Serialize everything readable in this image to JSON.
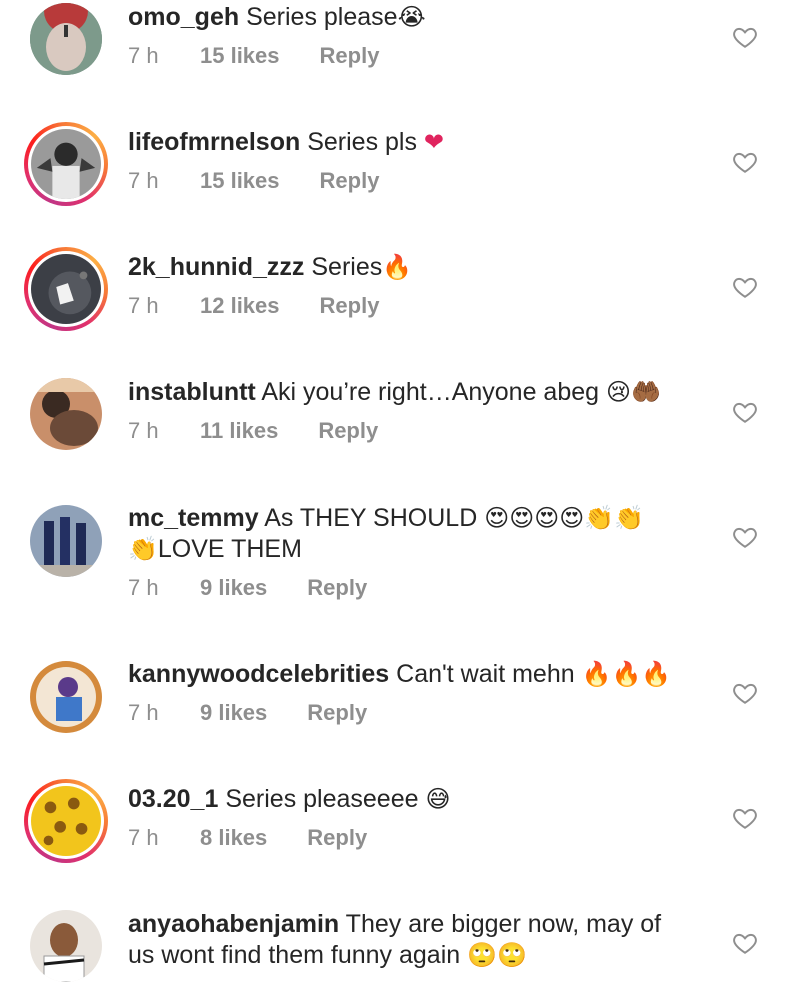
{
  "colors": {
    "text": "#262626",
    "meta": "#8e8e8e",
    "ring_start": "#c13584",
    "ring_end": "#fcaf45"
  },
  "comments": [
    {
      "username": "omo_geh",
      "text": "Series please",
      "emoji": "😭",
      "time": "7 h",
      "likes": "15 likes",
      "reply": "Reply"
    },
    {
      "username": "lifeofmrnelson",
      "text": "Series pls",
      "emoji": "❤",
      "time": "7 h",
      "likes": "15 likes",
      "reply": "Reply"
    },
    {
      "username": "2k_hunnid_zzz",
      "text": "Series",
      "emoji": "🔥",
      "time": "7 h",
      "likes": "12 likes",
      "reply": "Reply"
    },
    {
      "username": "instabluntt",
      "text": "Aki you’re right…Anyone abeg",
      "emoji": "😢🤲🏾",
      "time": "7 h",
      "likes": "11 likes",
      "reply": "Reply"
    },
    {
      "username": "mc_temmy",
      "text": "As THEY SHOULD",
      "emoji": "😍😍😍😍👏👏",
      "text2_emoji": "👏",
      "text2": "LOVE THEM",
      "time": "7 h",
      "likes": "9 likes",
      "reply": "Reply"
    },
    {
      "username": "kannywoodcelebrities",
      "text": "Can't wait mehn",
      "emoji": "🔥🔥🔥",
      "time": "7 h",
      "likes": "9 likes",
      "reply": "Reply"
    },
    {
      "username": "03.20_1",
      "text": "Series pleaseeee",
      "emoji": "😅",
      "time": "7 h",
      "likes": "8 likes",
      "reply": "Reply"
    },
    {
      "username": "anyaohabenjamin",
      "text": "They are bigger now, may of",
      "text2": "us wont find them funny again",
      "text2_emoji_after": "🙄🙄",
      "time": "",
      "likes": "",
      "reply": ""
    }
  ]
}
